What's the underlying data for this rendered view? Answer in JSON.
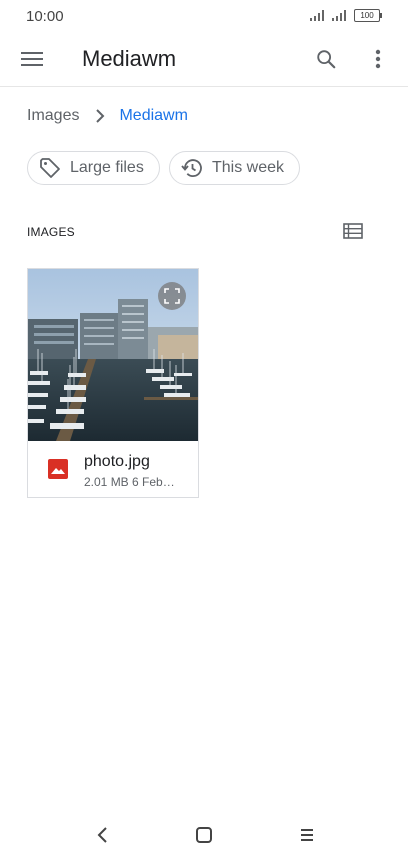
{
  "status_bar": {
    "time": "10:00",
    "battery": "100"
  },
  "app_bar": {
    "title": "Mediawm"
  },
  "breadcrumb": {
    "items": [
      "Images",
      "Mediawm"
    ]
  },
  "chips": [
    {
      "label": "Large files",
      "icon": "tag-icon"
    },
    {
      "label": "This week",
      "icon": "history-icon"
    }
  ],
  "section": {
    "title": "IMAGES",
    "view_icon": "list-view-icon"
  },
  "files": [
    {
      "name": "photo.jpg",
      "size": "2.01 MB",
      "date": "6 Feb…",
      "icon": "image-file-icon"
    }
  ],
  "colors": {
    "accent": "#1a73e8",
    "file_icon": "#d93025"
  }
}
